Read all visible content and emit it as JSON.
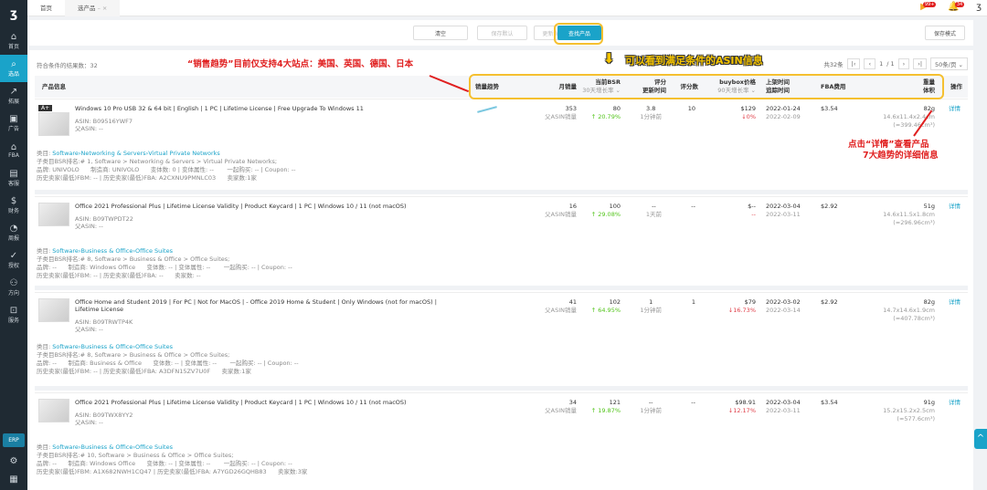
{
  "sidebar": {
    "items": [
      {
        "label": "首页",
        "icon": "⌂"
      },
      {
        "label": "选品",
        "icon": "⌕"
      },
      {
        "label": "拓展",
        "icon": "↗"
      },
      {
        "label": "广告",
        "icon": "▣"
      },
      {
        "label": "FBA",
        "icon": "⌂"
      },
      {
        "label": "客服",
        "icon": "▤"
      },
      {
        "label": "财务",
        "icon": "$"
      },
      {
        "label": "周报",
        "icon": "◔"
      },
      {
        "label": "授权",
        "icon": "✓"
      },
      {
        "label": "方向",
        "icon": "⚇"
      },
      {
        "label": "服务",
        "icon": "⊡"
      }
    ],
    "erp": "ERP"
  },
  "tabs": [
    {
      "label": "首页"
    },
    {
      "label": "选产品"
    }
  ],
  "notifications": {
    "badge1": "99+",
    "badge2": "34"
  },
  "toolbar": {
    "clear": "清空",
    "save_default": "保存默认",
    "update_default": "更新当前模式",
    "search": "查找产品",
    "save_mode": "保存模式"
  },
  "result_count": "符合条件的结果数：32",
  "pager": {
    "total": "共32条",
    "page": "1",
    "of": "/ 1",
    "per_page": "50条/页"
  },
  "headers": {
    "product": "产品信息",
    "trend": "销量趋势",
    "monthly": "月销量",
    "bsr": "当前BSR",
    "bsr_sub": "30天增长率",
    "rating": "评分",
    "rating_sub": "更新时间",
    "reviews": "评分数",
    "buybox": "buybox价格",
    "buybox_sub": "90天增长率",
    "listed": "上架时间",
    "tracked": "追踪时间",
    "fba": "FBA费用",
    "weight": "重量",
    "volume": "体积",
    "action": "操作"
  },
  "products": [
    {
      "title": "Windows 10 Pro USB 32 & 64 bit | English | 1 PC | Lifetime License | Free Upgrade To Windows 11",
      "badge": "A+",
      "asin": "ASIN: B09516YWF7",
      "parent": "父ASIN: --",
      "monthly": "353",
      "monthly_sub": "父ASIN销量",
      "bsr": "80",
      "bsr_growth": "↑ 20.79%",
      "rating": "3.8",
      "rating_time": "1分钟前",
      "reviews": "10",
      "price": "$129",
      "price_growth": "↓0%",
      "listed": "2022-01-24",
      "tracked": "2022-02-09",
      "fba": "$3.54",
      "weight": "82g",
      "dims": "14.6x11.4x2.4cm",
      "vol": "(≈399.46cm³)",
      "action": "详情",
      "cat_label": "类目:",
      "category": "Software›Networking & Servers›Virtual Private Networks",
      "sub_rank": "子类目BSR排名:# 1, Software > Networking & Servers > Virtual Private Networks;",
      "brand_line": "品牌: UNIVOLO      制造商: UNIVOLO      变体数: 0 | 变体属性: --       一起购买: -- | Coupon: --",
      "seller_line": "历史卖家(最低)FBM: -- | 历史卖家(最低)FBA: A2CXNU9PMNLC03      卖家数:1家"
    },
    {
      "title": "Office 2021 Professional Plus | Lifetime License Validity | Product Keycard | 1 PC | Windows 10 / 11 (not macOS)",
      "badge": "",
      "asin": "ASIN: B09TWPDT22",
      "parent": "父ASIN: --",
      "monthly": "16",
      "monthly_sub": "父ASIN销量",
      "bsr": "100",
      "bsr_growth": "↑ 29.08%",
      "rating": "--",
      "rating_time": "1天前",
      "reviews": "--",
      "price": "$--",
      "price_growth": "--",
      "listed": "2022-03-04",
      "tracked": "2022-03-11",
      "fba": "$2.92",
      "weight": "51g",
      "dims": "14.6x11.5x1.8cm",
      "vol": "(≈296.96cm³)",
      "action": "详情",
      "cat_label": "类目:",
      "category": "Software›Business & Office›Office Suites",
      "sub_rank": "子类目BSR排名:# 8, Software > Business & Office > Office Suites;",
      "brand_line": "品牌: --      制造商: Windows Office      变体数: -- | 变体属性: --       一起购买: -- | Coupon: --",
      "seller_line": "历史卖家(最低)FBM: -- | 历史卖家(最低)FBA: --      卖家数: --"
    },
    {
      "title": "Office Home and Student 2019 | For PC | Not for MacOS | - Office 2019 Home & Student | Only Windows (not for macOS) | Lifetime License",
      "badge": "",
      "asin": "ASIN: B09TRWTP4K",
      "parent": "父ASIN: --",
      "monthly": "41",
      "monthly_sub": "父ASIN销量",
      "bsr": "102",
      "bsr_growth": "↑ 64.95%",
      "rating": "1",
      "rating_time": "1分钟前",
      "reviews": "1",
      "price": "$79",
      "price_growth": "↓16.73%",
      "listed": "2022-03-02",
      "tracked": "2022-03-14",
      "fba": "$2.92",
      "weight": "82g",
      "dims": "14.7x14.6x1.9cm",
      "vol": "(≈407.78cm³)",
      "action": "详情",
      "cat_label": "类目:",
      "category": "Software›Business & Office›Office Suites",
      "sub_rank": "子类目BSR排名:# 8, Software > Business & Office > Office Suites;",
      "brand_line": "品牌: --      制造商: Business & Office      变体数: -- | 变体属性: --       一起购买: -- | Coupon: --",
      "seller_line": "历史卖家(最低)FBM: -- | 历史卖家(最低)FBA: A3DFN15ZV7U0F      卖家数:1家"
    },
    {
      "title": "Office 2021 Professional Plus | Lifetime License Validity | Product Keycard | 1 PC | Windows 10 / 11 (not macOS)",
      "badge": "",
      "asin": "ASIN: B09TWX8YY2",
      "parent": "父ASIN: --",
      "monthly": "34",
      "monthly_sub": "父ASIN销量",
      "bsr": "121",
      "bsr_growth": "↑ 19.87%",
      "rating": "--",
      "rating_time": "1分钟前",
      "reviews": "--",
      "price": "$98.91",
      "price_growth": "↓12.17%",
      "listed": "2022-03-04",
      "tracked": "2022-03-11",
      "fba": "$3.54",
      "weight": "91g",
      "dims": "15.2x15.2x2.5cm",
      "vol": "(≈577.6cm³)",
      "action": "详情",
      "cat_label": "类目:",
      "category": "Software›Business & Office›Office Suites",
      "sub_rank": "子类目BSR排名:# 10, Software > Business & Office > Office Suites;",
      "brand_line": "品牌: --      制造商: Windows Office      变体数: -- | 变体属性: --       一起购买: -- | Coupon: --",
      "seller_line": "历史卖家(最低)FBM: A1X682NWH1CQ47 | 历史卖家(最低)FBA: A7YGD26GQHB83      卖家数:3家"
    }
  ],
  "annotations": {
    "trend_note": "“销售趋势”目前仅支持4大站点：美国、英国、德国、日本",
    "asin_note": "可以看到满足条件的ASIN信息",
    "detail_note1": "点击“详情”查看产品",
    "detail_note2": "7大趋势的详细信息"
  }
}
